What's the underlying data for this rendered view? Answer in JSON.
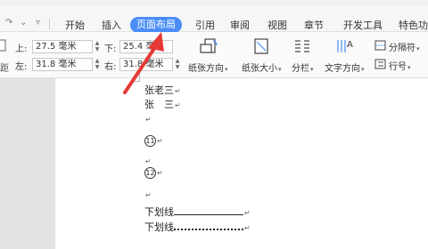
{
  "tabs": [
    "开始",
    "插入",
    "页面布局",
    "引用",
    "审阅",
    "视图",
    "章节",
    "开发工具",
    "特色功"
  ],
  "active_tab": "页面布局",
  "margins": {
    "top_label": "上:",
    "top_value": "27.5 毫米",
    "bottom_label": "下:",
    "bottom_value": "25.4 毫米",
    "left_label": "左:",
    "left_value": "31.8 毫米",
    "right_label": "右:",
    "right_value": "31.8 毫米"
  },
  "ribbon": {
    "orientation": "纸张方向",
    "size": "纸张大小",
    "columns": "分栏",
    "text_direction": "文字方向",
    "separator": "分隔符",
    "line_number": "行号"
  },
  "doc": {
    "line1": "张老三",
    "line2": "张　三",
    "line3_num": "11",
    "line4_num": "12",
    "underline_label": "下划线",
    "dotted_label": "下划线",
    "para_mark": "↵"
  },
  "colors": {
    "accent": "#4a8df8",
    "arrow": "#e53935"
  }
}
